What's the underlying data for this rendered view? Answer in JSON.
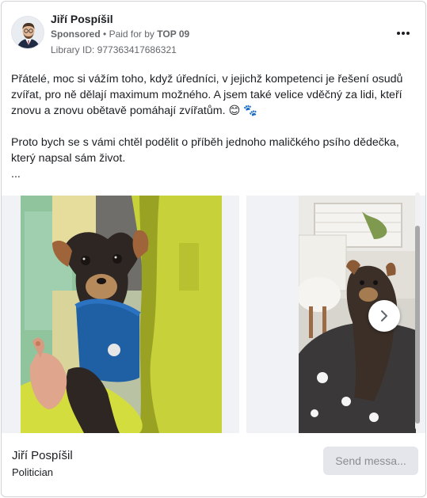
{
  "advertiser": {
    "name": "Jiří Pospíšil",
    "sponsored_label": "Sponsored",
    "separator": "•",
    "paid_for_prefix": "Paid for by",
    "payer": "TOP 09",
    "library_id": "Library ID: 977363417686321"
  },
  "post": {
    "paragraph1": "Přátelé, moc si vážím toho, když úředníci, v jejichž kompetenci je řešení osudů zvířat, pro ně dělají maximum možného. A jsem také velice vděčný za lidi, kteří znovu a znovu obětavě pomáhají zvířatům. 😊 🐾",
    "paragraph2": "Proto bych se s vámi chtěl podělit o příběh jednoho maličkého psího dědečka, který napsal sám život.",
    "ellipsis": "..."
  },
  "footer": {
    "page_name": "Jiří Pospíšil",
    "category": "Politician",
    "cta_label": "Send messa..."
  },
  "colors": {
    "text": "#1c1e21",
    "secondary_text": "#65676b",
    "button_bg": "#e4e6eb",
    "card_border": "#cfd2d6"
  },
  "icons": {
    "more": "more-horizontal-icon",
    "next": "chevron-right-icon"
  }
}
